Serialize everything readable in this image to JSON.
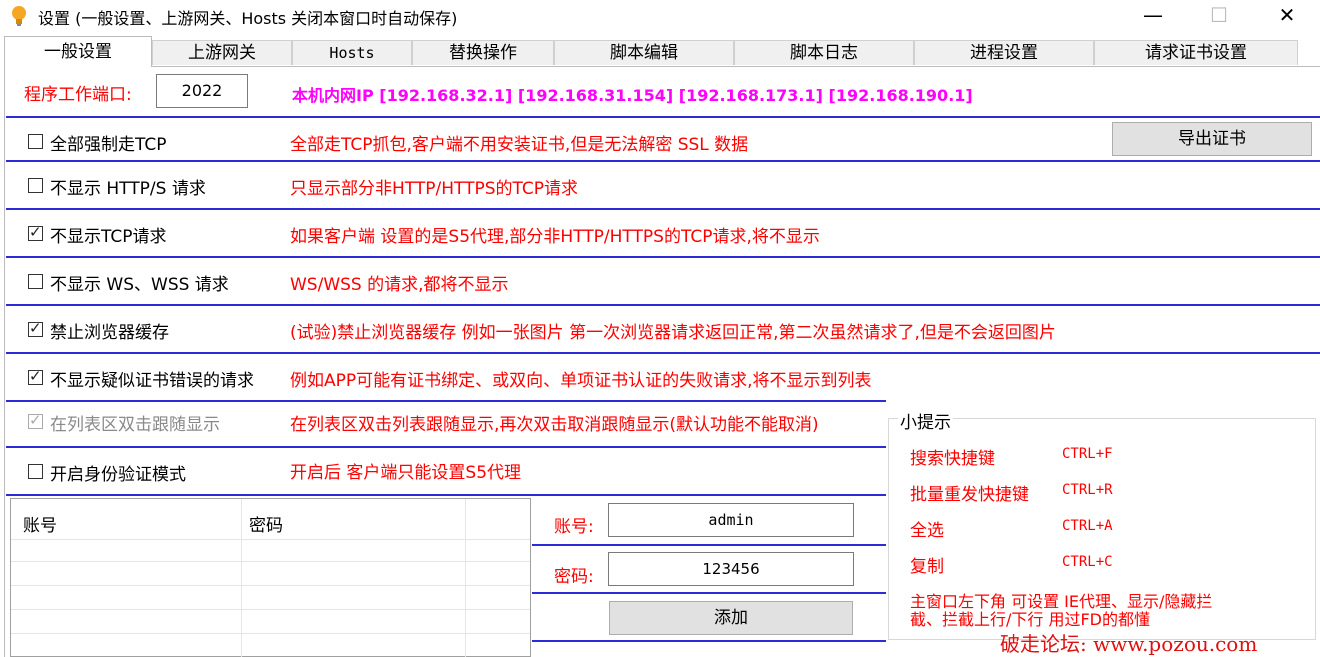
{
  "window": {
    "title": "设置 (一般设置、上游网关、Hosts 关闭本窗口时自动保存)",
    "minimize": "—",
    "maximize": "☐",
    "close": "✕"
  },
  "tabs": [
    {
      "label": "一般设置"
    },
    {
      "label": "上游网关"
    },
    {
      "label": "Hosts"
    },
    {
      "label": "替换操作"
    },
    {
      "label": "脚本编辑"
    },
    {
      "label": "脚本日志"
    },
    {
      "label": "进程设置"
    },
    {
      "label": "请求证书设置"
    }
  ],
  "port": {
    "label": "程序工作端口:",
    "value": "2022",
    "ip_info": "本机内网IP [192.168.32.1] [192.168.31.154] [192.168.173.1] [192.168.190.1]"
  },
  "export_cert_button": "导出证书",
  "options": [
    {
      "label": "全部强制走TCP",
      "checked": false,
      "desc": "全部走TCP抓包,客户端不用安装证书,但是无法解密 SSL 数据"
    },
    {
      "label": "不显示 HTTP/S 请求",
      "checked": false,
      "desc": "只显示部分非HTTP/HTTPS的TCP请求"
    },
    {
      "label": "不显示TCP请求",
      "checked": true,
      "desc": "如果客户端 设置的是S5代理,部分非HTTP/HTTPS的TCP请求,将不显示"
    },
    {
      "label": "不显示 WS、WSS 请求",
      "checked": false,
      "desc": "WS/WSS 的请求,都将不显示"
    },
    {
      "label": "禁止浏览器缓存",
      "checked": true,
      "desc": "(试验)禁止浏览器缓存 例如一张图片 第一次浏览器请求返回正常,第二次虽然请求了,但是不会返回图片"
    },
    {
      "label": "不显示疑似证书错误的请求",
      "checked": true,
      "desc": "例如APP可能有证书绑定、或双向、单项证书认证的失败请求,将不显示到列表"
    },
    {
      "label": "在列表区双击跟随显示",
      "checked": true,
      "disabled": true,
      "desc": "在列表区双击列表跟随显示,再次双击取消跟随显示(默认功能不能取消)"
    },
    {
      "label": "开启身份验证模式",
      "checked": false,
      "desc": "开启后 客户端只能设置S5代理"
    }
  ],
  "auth_table": {
    "columns": [
      "账号",
      "密码"
    ]
  },
  "auth_form": {
    "account_label": "账号:",
    "account_value": "admin",
    "password_label": "密码:",
    "password_value": "123456",
    "add_button": "添加"
  },
  "tips": {
    "title": "小提示",
    "items": [
      {
        "name": "搜索快捷键",
        "key": "CTRL+F"
      },
      {
        "name": "批量重发快捷键",
        "key": "CTRL+R"
      },
      {
        "name": "全选",
        "key": "CTRL+A"
      },
      {
        "name": "复制",
        "key": "CTRL+C"
      }
    ],
    "note_line1": "主窗口左下角 可设置 IE代理、显示/隐藏拦",
    "note_line2": "截、拦截上行/下行 用过FD的都懂"
  },
  "watermark": "破走论坛: www.pozou.com",
  "colors": {
    "accent_line": "#2b2bd8",
    "red_text": "#ff0000",
    "ip_text": "#ff00ff"
  }
}
